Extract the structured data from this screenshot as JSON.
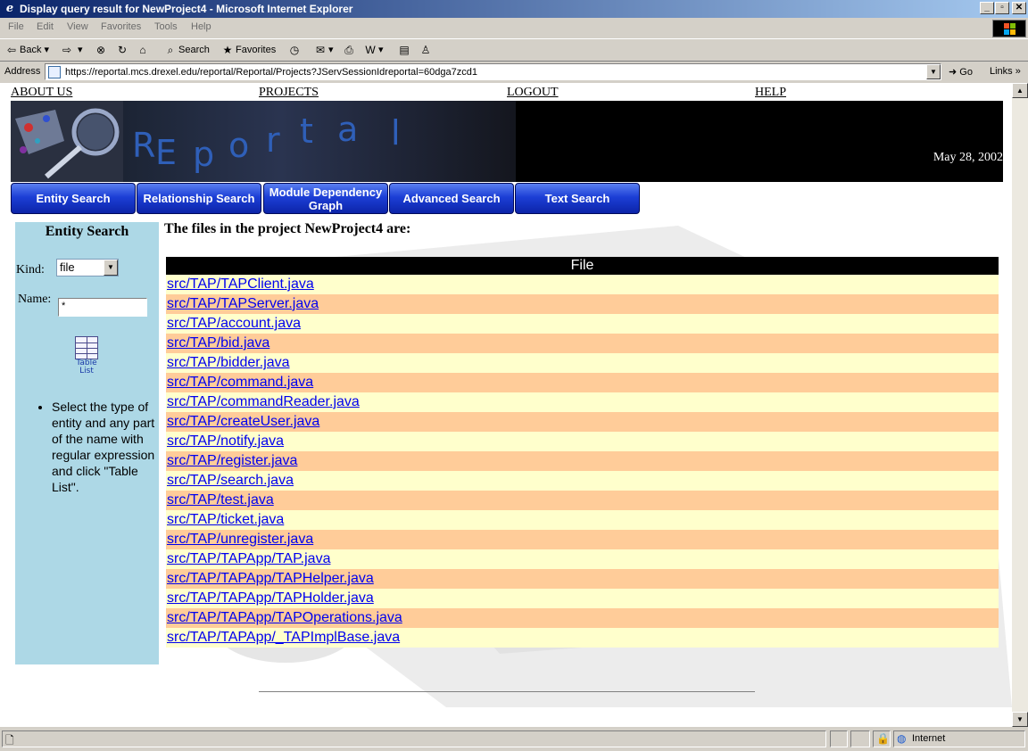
{
  "window": {
    "title": "Display query result for NewProject4 - Microsoft Internet Explorer"
  },
  "menu": [
    "File",
    "Edit",
    "View",
    "Favorites",
    "Tools",
    "Help"
  ],
  "toolbar": {
    "back": "Back",
    "search": "Search",
    "favorites": "Favorites"
  },
  "addressbar": {
    "label": "Address",
    "url": "https://reportal.mcs.drexel.edu/reportal/Reportal/Projects?JServSessionIdreportal=60dga7zcd1",
    "go": "Go",
    "links": "Links"
  },
  "page": {
    "top_nav": [
      "ABOUT US",
      "PROJECTS",
      "LOGOUT",
      "HELP"
    ],
    "logo_letters": [
      "R",
      "E",
      "p",
      "o",
      "r",
      "t",
      "a",
      "l"
    ],
    "date": "May 28, 2002",
    "nav_buttons": [
      "Entity Search",
      "Relationship Search",
      "Module Dependency Graph",
      "Advanced Search",
      "Text Search"
    ],
    "sidebar": {
      "title": "Entity Search",
      "kind_label": "Kind:",
      "kind_value": "file",
      "name_label": "Name:",
      "name_value": "*",
      "table_list_label": "Table List",
      "help_text": "Select the type of entity and any part of the name with regular expression and click \"Table List\"."
    },
    "heading": "The files in the project NewProject4 are:",
    "table_header": "File",
    "files": [
      "src/TAP/TAPClient.java",
      "src/TAP/TAPServer.java",
      "src/TAP/account.java",
      "src/TAP/bid.java",
      "src/TAP/bidder.java",
      "src/TAP/command.java",
      "src/TAP/commandReader.java",
      "src/TAP/createUser.java",
      "src/TAP/notify.java",
      "src/TAP/register.java",
      "src/TAP/search.java",
      "src/TAP/test.java",
      "src/TAP/ticket.java",
      "src/TAP/unregister.java",
      "src/TAP/TAPApp/TAP.java",
      "src/TAP/TAPApp/TAPHelper.java",
      "src/TAP/TAPApp/TAPHolder.java",
      "src/TAP/TAPApp/TAPOperations.java",
      "src/TAP/TAPApp/_TAPImplBase.java"
    ]
  },
  "status": {
    "zone": "Internet"
  },
  "colors": {
    "title_bar": "#0a246a",
    "sidebar_bg": "#add8e6",
    "row_light": "#ffffcc",
    "row_dark": "#ffcc99",
    "nav_button": "#1c3fd6"
  }
}
